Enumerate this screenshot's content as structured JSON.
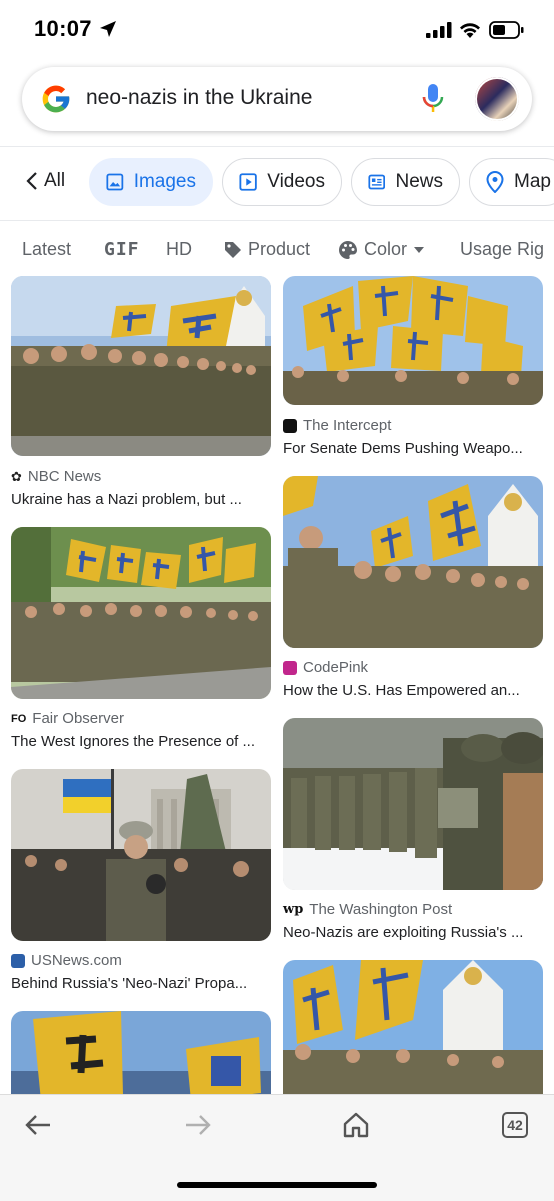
{
  "status_bar": {
    "time": "10:07"
  },
  "search": {
    "query": "neo-nazis in the Ukraine"
  },
  "tabs": {
    "back_label": "All",
    "items": [
      {
        "label": "Images",
        "icon": "image-icon",
        "active": true
      },
      {
        "label": "Videos",
        "icon": "play-icon",
        "active": false
      },
      {
        "label": "News",
        "icon": "news-icon",
        "active": false
      },
      {
        "label": "Map",
        "icon": "map-pin-icon",
        "active": false
      }
    ]
  },
  "filters": {
    "items": [
      "Latest",
      "GIF",
      "HD",
      "Product",
      "Color",
      "Usage Rig"
    ]
  },
  "results": {
    "left": [
      {
        "source": "NBC News",
        "title": "Ukraine has a Nazi problem, but ...",
        "favicon": "nbc-peacock-icon",
        "favicon_color": "#222222"
      },
      {
        "source": "Fair Observer",
        "title": "The West Ignores the Presence of ...",
        "favicon": "fo-icon",
        "favicon_color": "#111111"
      },
      {
        "source": "USNews.com",
        "title": "Behind Russia's 'Neo-Nazi' Propa...",
        "favicon": "usnews-icon",
        "favicon_color": "#2c5fa8"
      },
      {
        "source": "",
        "title": "",
        "favicon": "",
        "favicon_color": ""
      }
    ],
    "right": [
      {
        "source": "The Intercept",
        "title": "For Senate Dems Pushing Weapo...",
        "favicon": "intercept-icon",
        "favicon_color": "#111111"
      },
      {
        "source": "CodePink",
        "title": "How the U.S. Has Empowered an...",
        "favicon": "codepink-icon",
        "favicon_color": "#c1268c"
      },
      {
        "source": "The Washington Post",
        "title": "Neo-Nazis are exploiting Russia's ...",
        "favicon": "wapo-icon",
        "favicon_color": "#111111"
      },
      {
        "source": "",
        "title": "",
        "favicon": "",
        "favicon_color": ""
      }
    ]
  },
  "toolbar": {
    "tab_count": "42"
  },
  "colors": {
    "accent": "#1a73e8",
    "chip_active_bg": "#e8f0fe",
    "flag_yellow": "#e3b62a",
    "flag_blue": "#3557a8",
    "uniform": "#6f6a4f"
  }
}
